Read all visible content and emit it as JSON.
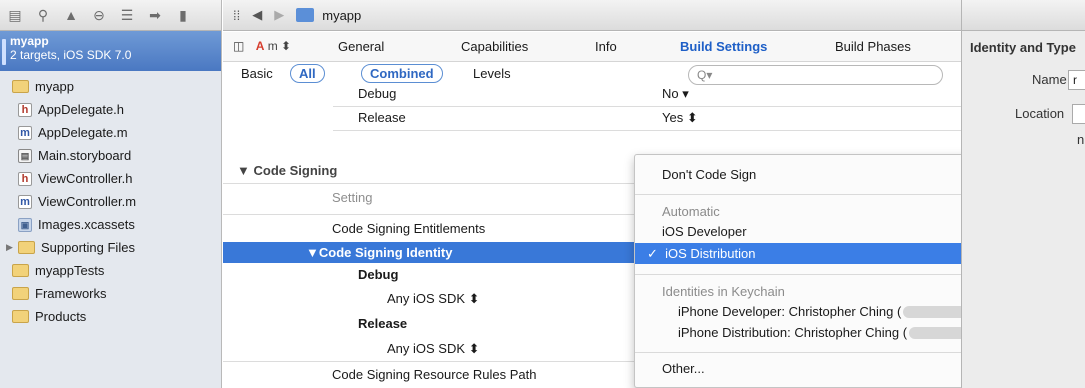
{
  "navigator": {
    "toolbar_icons": [
      "folder-icon",
      "search-icon",
      "warning-icon",
      "breakpoint-icon",
      "list-icon",
      "tag-icon",
      "log-icon"
    ],
    "project": {
      "name": "myapp",
      "subtitle": "2 targets, iOS SDK 7.0"
    },
    "items": [
      {
        "label": "myapp",
        "type": "folder"
      },
      {
        "label": "AppDelegate.h",
        "type": "h"
      },
      {
        "label": "AppDelegate.m",
        "type": "m"
      },
      {
        "label": "Main.storyboard",
        "type": "storyboard"
      },
      {
        "label": "ViewController.h",
        "type": "h"
      },
      {
        "label": "ViewController.m",
        "type": "m"
      },
      {
        "label": "Images.xcassets",
        "type": "xcassets"
      },
      {
        "label": "Supporting Files",
        "type": "folder"
      },
      {
        "label": "myappTests",
        "type": "folder"
      },
      {
        "label": "Frameworks",
        "type": "folder"
      },
      {
        "label": "Products",
        "type": "folder"
      }
    ]
  },
  "jumpbar": {
    "title": "myapp"
  },
  "tabs": {
    "target": "m",
    "general": "General",
    "capabilities": "Capabilities",
    "info": "Info",
    "build_settings": "Build Settings",
    "build_phases": "Build Phases"
  },
  "filter": {
    "basic": "Basic",
    "all": "All",
    "combined": "Combined",
    "levels": "Levels",
    "search_icon": "Q▾"
  },
  "rows": {
    "debug_top": "Debug",
    "debug_top_val": "No ▾",
    "release_top": "Release",
    "release_top_val": "Yes ⬍",
    "section": "Code Signing",
    "setting_header": "Setting",
    "entitlements": "Code Signing Entitlements",
    "identity": "Code Signing Identity",
    "debug": "Debug",
    "debug_val": "Any iOS SDK ⬍",
    "release": "Release",
    "release_val": "Any iOS SDK ⬍",
    "rules_path": "Code Signing Resource Rules Path"
  },
  "menu": {
    "dont_sign": "Don't Code Sign",
    "automatic_header": "Automatic",
    "ios_developer": "iOS Developer",
    "ios_distribution": "iOS Distribution",
    "keychain_header": "Identities in Keychain",
    "iphone_dev": "iPhone Developer: Christopher Ching (",
    "iphone_dev_close": ")",
    "iphone_dist": "iPhone Distribution: Christopher Ching (",
    "other": "Other..."
  },
  "inspector": {
    "header": "Identity and Type",
    "name_label": "Name",
    "name_value": "r",
    "location_label": "Location",
    "extra": "n"
  }
}
